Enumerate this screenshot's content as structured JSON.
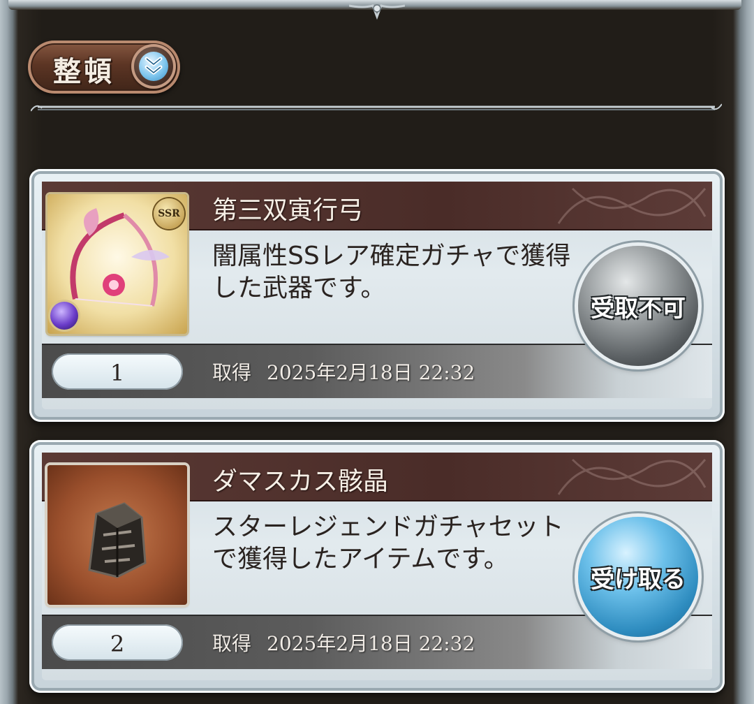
{
  "toolbar": {
    "sort_label": "整頓",
    "sort_toggle_icon": "double-chevron-down-icon"
  },
  "items": [
    {
      "name": "第三双寅行弓",
      "description": "闇属性SSレア確定ガチャで獲得した武器です。",
      "rarity": "SSR",
      "element_icon": "dark-element-icon",
      "thumbnail_icon": "bow-weapon-icon",
      "quantity": "1",
      "acquired_label": "取得",
      "acquired_date": "2025年2月18日 22:32",
      "action_label": "受取不可",
      "action_enabled": false
    },
    {
      "name": "ダマスカス骸晶",
      "description": "スターレジェンドガチャセットで獲得したアイテムです。",
      "thumbnail_icon": "damascus-crystal-icon",
      "quantity": "2",
      "acquired_label": "取得",
      "acquired_date": "2025年2月18日 22:32",
      "action_label": "受け取る",
      "action_enabled": true
    }
  ],
  "colors": {
    "panel_bg": "#211d18",
    "title_band": "#4a2c28",
    "receive_button": "#2f8dc0",
    "disabled_button": "#595e61"
  }
}
